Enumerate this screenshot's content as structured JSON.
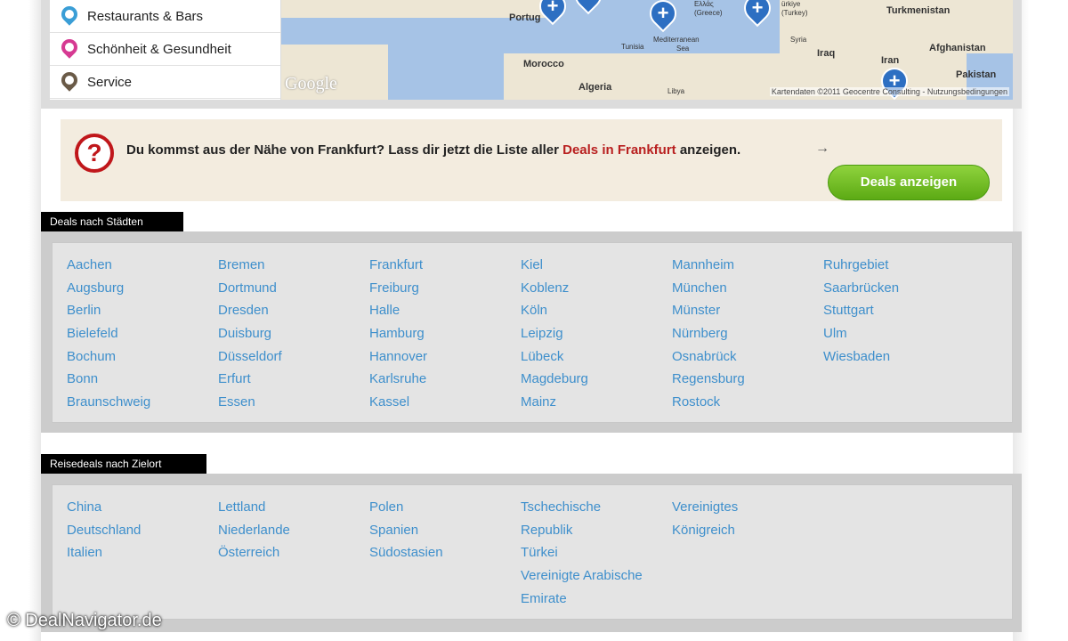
{
  "categories": [
    {
      "label": "Restaurants & Bars",
      "icon": "restaurant-icon",
      "color": "#3a9ed6"
    },
    {
      "label": "Schönheit & Gesundheit",
      "icon": "beauty-icon",
      "color": "#d63a92"
    },
    {
      "label": "Service",
      "icon": "service-icon",
      "color": "#6a5a47"
    }
  ],
  "map": {
    "logo": "Google",
    "attribution": "Kartendaten ©2011 Geocentre Consulting - Nutzungsbedingungen",
    "labels": {
      "portugal": "Portug",
      "morocco": "Morocco",
      "algeria": "Algeria",
      "libya": "Libya",
      "tunisia": "Tunisia",
      "mediterranean": "Mediterranean",
      "sea": "Sea",
      "greece": "Ελλάς",
      "greece_sub": "(Greece)",
      "turkey": "ürkiye",
      "turkey_sub": "(Turkey)",
      "syria": "Syria",
      "iraq": "Iraq",
      "iran": "Iran",
      "turkmenistan": "Turkmenistan",
      "afghanistan": "Afghanistan",
      "pakistan": "Pakistan"
    }
  },
  "notice": {
    "text_before": "Du kommst aus der Nähe von Frankfurt? Lass dir jetzt die Liste aller ",
    "highlight": "Deals in Frankfurt",
    "text_after": " anzeigen.",
    "arrow": "→",
    "button": "Deals anzeigen",
    "icon": "?"
  },
  "cities": {
    "title": "Deals nach Städten",
    "columns": [
      [
        "Aachen",
        "Augsburg",
        "Berlin",
        "Bielefeld",
        "Bochum",
        "Bonn",
        "Braunschweig"
      ],
      [
        "Bremen",
        "Dortmund",
        "Dresden",
        "Duisburg",
        "Düsseldorf",
        "Erfurt",
        "Essen"
      ],
      [
        "Frankfurt",
        "Freiburg",
        "Halle",
        "Hamburg",
        "Hannover",
        "Karlsruhe",
        "Kassel"
      ],
      [
        "Kiel",
        "Koblenz",
        "Köln",
        "Leipzig",
        "Lübeck",
        "Magdeburg",
        "Mainz"
      ],
      [
        "Mannheim",
        "München",
        "Münster",
        "Nürnberg",
        "Osnabrück",
        "Regensburg",
        "Rostock"
      ],
      [
        "Ruhrgebiet",
        "Saarbrücken",
        "Stuttgart",
        "Ulm",
        "Wiesbaden"
      ]
    ]
  },
  "travel": {
    "title": "Reisedeals nach Zielort",
    "columns": [
      [
        "China",
        "Deutschland",
        "Italien"
      ],
      [
        "Lettland",
        "Niederlande",
        "Österreich"
      ],
      [
        "Polen",
        "Spanien",
        "Südostasien"
      ],
      [
        "Tschechische",
        "Republik",
        "Türkei",
        "Vereinigte Arabische",
        "Emirate"
      ],
      [
        "Vereinigtes",
        "Königreich"
      ]
    ]
  },
  "copyright": "© DealNavigator.de",
  "colors": {
    "link": "#3e8fcc",
    "highlight": "#b81f1f",
    "button": "#6cbf1e",
    "notice_bg": "#f3ecdf"
  }
}
